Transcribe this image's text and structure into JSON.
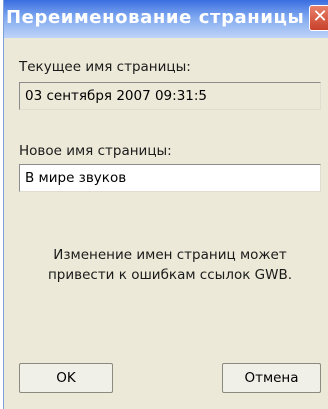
{
  "window": {
    "title": "Переименование страницы",
    "close_glyph": "✕"
  },
  "current_name": {
    "label": "Текущее имя страницы:",
    "value": "03 сентября 2007 09:31:5"
  },
  "new_name": {
    "label": "Новое имя страницы:",
    "value": "В мире звуков"
  },
  "note": {
    "line1": "Изменение имен страниц может",
    "line2": "привести к ошибкам ссылок GWB."
  },
  "buttons": {
    "ok": "OK",
    "cancel": "Отмена"
  }
}
